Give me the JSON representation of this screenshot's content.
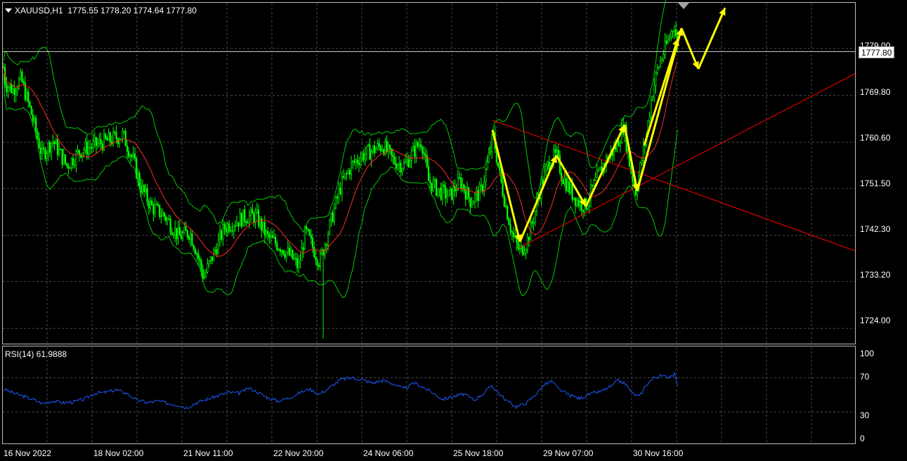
{
  "header": {
    "symbol": "XAUUSD,H1",
    "ohlc": "1775.55 1778.20 1774.64 1777.80"
  },
  "current_price": "1777.80",
  "current_price_label_partial": "1779.00",
  "price_axis": [
    "1769.80",
    "1760.60",
    "1751.50",
    "1742.30",
    "1733.20",
    "1724.00"
  ],
  "rsi": {
    "label": "RSI(14) 61.9888",
    "axis": [
      "100",
      "70",
      "30",
      "0"
    ]
  },
  "time_axis": [
    "16 Nov 2022",
    "18 Nov 02:00",
    "21 Nov 11:00",
    "22 Nov 20:00",
    "24 Nov 06:00",
    "25 Nov 18:00",
    "29 Nov 07:00",
    "30 Nov 16:00"
  ],
  "colors": {
    "background": "#000000",
    "candles": "#00ff00",
    "bands": "#00c800",
    "ma": "#ff2a2a",
    "trendlines": "#ff0000",
    "arrows": "#ffff00",
    "rsi_line": "#1e5bff",
    "grid": "#4a4a4a"
  },
  "chart_data": {
    "type": "candlestick",
    "symbol": "XAUUSD",
    "timeframe": "H1",
    "last_close": 1777.8,
    "ylim": [
      1721,
      1788
    ],
    "price_path": [
      [
        0,
        1781
      ],
      [
        8,
        1772
      ],
      [
        18,
        1771
      ],
      [
        30,
        1773
      ],
      [
        45,
        1766
      ],
      [
        60,
        1758
      ],
      [
        75,
        1761
      ],
      [
        95,
        1756
      ],
      [
        115,
        1759
      ],
      [
        135,
        1760
      ],
      [
        155,
        1761
      ],
      [
        175,
        1762
      ],
      [
        190,
        1757
      ],
      [
        200,
        1752
      ],
      [
        215,
        1748
      ],
      [
        235,
        1746
      ],
      [
        255,
        1742
      ],
      [
        270,
        1743
      ],
      [
        280,
        1739
      ],
      [
        290,
        1734
      ],
      [
        305,
        1739
      ],
      [
        320,
        1744
      ],
      [
        335,
        1745
      ],
      [
        350,
        1746
      ],
      [
        365,
        1746
      ],
      [
        380,
        1742
      ],
      [
        400,
        1740
      ],
      [
        415,
        1738
      ],
      [
        425,
        1736
      ],
      [
        435,
        1743
      ],
      [
        445,
        1740
      ],
      [
        455,
        1737
      ],
      [
        465,
        1742
      ],
      [
        475,
        1747
      ],
      [
        485,
        1752
      ],
      [
        500,
        1756
      ],
      [
        515,
        1758
      ],
      [
        530,
        1759
      ],
      [
        545,
        1760
      ],
      [
        560,
        1757
      ],
      [
        575,
        1756
      ],
      [
        590,
        1759
      ],
      [
        600,
        1761
      ],
      [
        610,
        1753
      ],
      [
        625,
        1751
      ],
      [
        640,
        1750
      ],
      [
        655,
        1753
      ],
      [
        670,
        1749
      ],
      [
        685,
        1751
      ],
      [
        695,
        1757
      ],
      [
        702,
        1762
      ],
      [
        710,
        1755
      ],
      [
        720,
        1748
      ],
      [
        730,
        1742
      ],
      [
        740,
        1739
      ],
      [
        750,
        1741
      ],
      [
        760,
        1746
      ],
      [
        770,
        1752
      ],
      [
        782,
        1757
      ],
      [
        792,
        1758
      ],
      [
        800,
        1754
      ],
      [
        812,
        1751
      ],
      [
        822,
        1749
      ],
      [
        833,
        1748
      ],
      [
        845,
        1752
      ],
      [
        858,
        1756
      ],
      [
        868,
        1758
      ],
      [
        878,
        1760
      ],
      [
        888,
        1764
      ],
      [
        895,
        1757
      ],
      [
        905,
        1751
      ],
      [
        912,
        1756
      ],
      [
        920,
        1762
      ],
      [
        928,
        1770
      ],
      [
        936,
        1775
      ],
      [
        944,
        1778
      ],
      [
        952,
        1781
      ],
      [
        960,
        1784
      ],
      [
        965,
        1778
      ]
    ],
    "rsi_path": [
      [
        5,
        57
      ],
      [
        20,
        52
      ],
      [
        35,
        48
      ],
      [
        50,
        44
      ],
      [
        60,
        40
      ],
      [
        75,
        43
      ],
      [
        90,
        41
      ],
      [
        105,
        42
      ],
      [
        120,
        45
      ],
      [
        135,
        52
      ],
      [
        150,
        53
      ],
      [
        165,
        56
      ],
      [
        180,
        52
      ],
      [
        195,
        44
      ],
      [
        210,
        41
      ],
      [
        225,
        43
      ],
      [
        240,
        40
      ],
      [
        255,
        38
      ],
      [
        265,
        35
      ],
      [
        280,
        41
      ],
      [
        295,
        45
      ],
      [
        310,
        49
      ],
      [
        325,
        53
      ],
      [
        340,
        52
      ],
      [
        355,
        58
      ],
      [
        365,
        54
      ],
      [
        380,
        47
      ],
      [
        395,
        43
      ],
      [
        410,
        46
      ],
      [
        425,
        52
      ],
      [
        440,
        57
      ],
      [
        455,
        51
      ],
      [
        470,
        59
      ],
      [
        485,
        68
      ],
      [
        500,
        70
      ],
      [
        515,
        68
      ],
      [
        530,
        64
      ],
      [
        545,
        67
      ],
      [
        560,
        63
      ],
      [
        575,
        57
      ],
      [
        590,
        64
      ],
      [
        600,
        60
      ],
      [
        615,
        53
      ],
      [
        630,
        45
      ],
      [
        645,
        48
      ],
      [
        660,
        51
      ],
      [
        675,
        44
      ],
      [
        690,
        53
      ],
      [
        700,
        61
      ],
      [
        710,
        52
      ],
      [
        720,
        44
      ],
      [
        735,
        36
      ],
      [
        750,
        41
      ],
      [
        765,
        53
      ],
      [
        775,
        62
      ],
      [
        785,
        66
      ],
      [
        795,
        57
      ],
      [
        810,
        50
      ],
      [
        825,
        46
      ],
      [
        840,
        51
      ],
      [
        855,
        54
      ],
      [
        870,
        60
      ],
      [
        880,
        67
      ],
      [
        890,
        63
      ],
      [
        900,
        52
      ],
      [
        910,
        48
      ],
      [
        920,
        62
      ],
      [
        930,
        70
      ],
      [
        940,
        72
      ],
      [
        950,
        71
      ],
      [
        960,
        74
      ],
      [
        965,
        61
      ]
    ],
    "arrows": [
      [
        [
          701,
          1763
        ],
        [
          740,
          1741
        ]
      ],
      [
        [
          740,
          1741
        ],
        [
          792,
          1758
        ]
      ],
      [
        [
          792,
          1758
        ],
        [
          834,
          1748
        ]
      ],
      [
        [
          834,
          1748
        ],
        [
          889,
          1764
        ]
      ],
      [
        [
          889,
          1764
        ],
        [
          907,
          1751
        ]
      ],
      [
        [
          907,
          1751
        ],
        [
          970,
          1783
        ]
      ],
      [
        [
          970,
          1783
        ],
        [
          994,
          1775
        ]
      ],
      [
        [
          994,
          1775
        ],
        [
          1032,
          1787
        ]
      ],
      [
        [
          917,
          1760
        ],
        [
          965,
          1781
        ]
      ]
    ]
  }
}
